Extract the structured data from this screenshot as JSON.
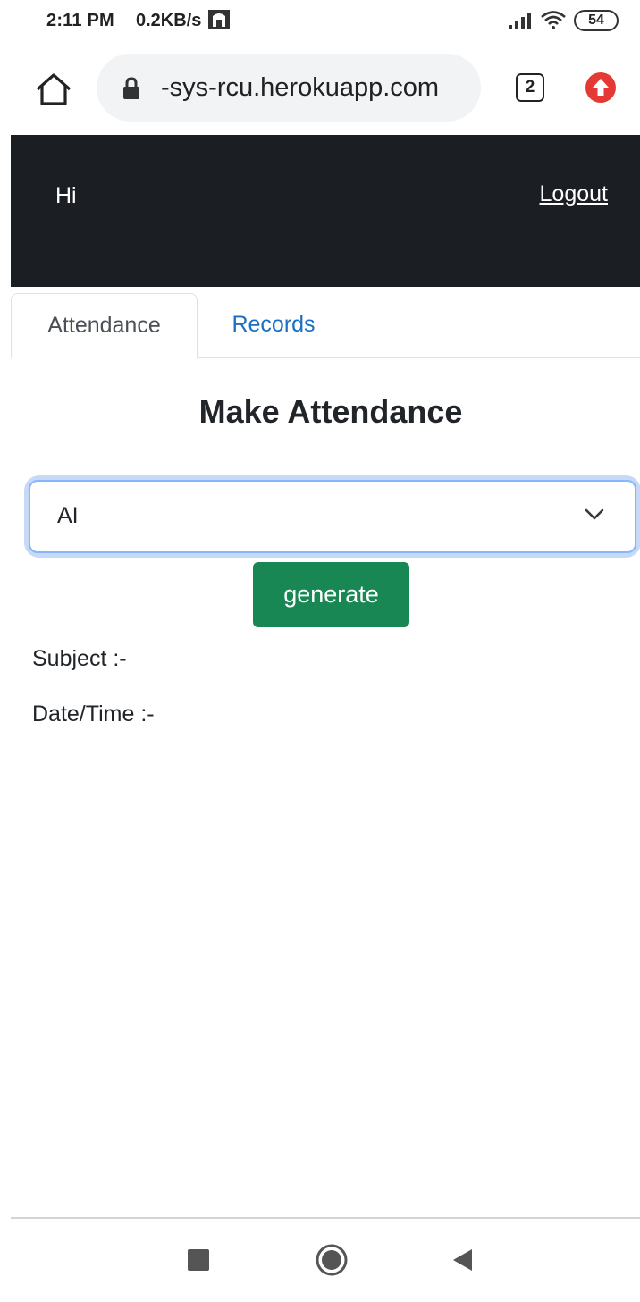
{
  "status": {
    "time": "2:11 PM",
    "net_speed": "0.2KB/s",
    "battery": "54"
  },
  "browser": {
    "url": "-sys-rcu.herokuapp.com",
    "tab_count": "2"
  },
  "header": {
    "greeting": "Hi",
    "logout_label": "Logout"
  },
  "tabs": [
    {
      "label": "Attendance",
      "active": true
    },
    {
      "label": "Records",
      "active": false
    }
  ],
  "main": {
    "title": "Make Attendance",
    "subject_select": {
      "selected": "AI"
    },
    "generate_label": "generate",
    "subject_label": "Subject :-",
    "datetime_label": "Date/Time :-"
  },
  "colors": {
    "header_bg": "#1b1e22",
    "link_blue": "#1a6fc4",
    "button_green": "#198754",
    "focus_border": "#86b7fe",
    "update_red": "#e53935"
  },
  "icons": [
    "notification-icon",
    "signal-icon",
    "wifi-icon",
    "home-icon",
    "lock-icon",
    "update-icon",
    "chevron-down-icon",
    "nav-recents-icon",
    "nav-home-icon",
    "nav-back-icon"
  ]
}
